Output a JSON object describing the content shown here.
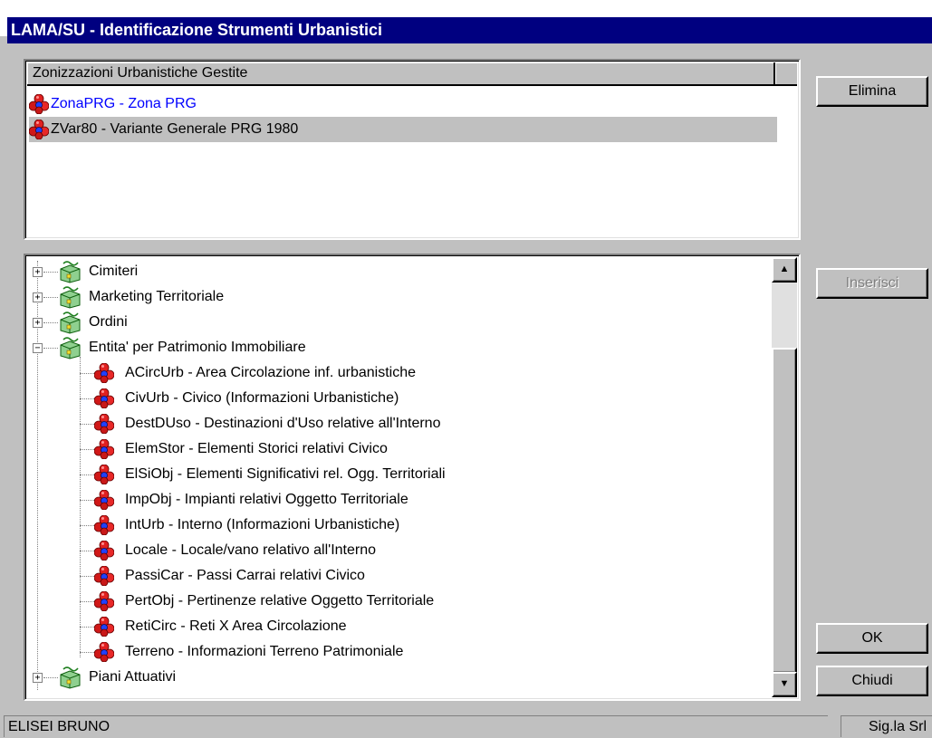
{
  "window": {
    "title": "LAMA/SU - Identificazione Strumenti Urbanistici"
  },
  "managed_list": {
    "header": "Zonizzazioni Urbanistiche Gestite",
    "items": [
      {
        "label": "ZonaPRG - Zona PRG",
        "icon": "entity-cluster-icon"
      },
      {
        "label": "ZVar80 - Variante Generale PRG 1980",
        "icon": "entity-cluster-icon"
      }
    ]
  },
  "tree": {
    "groups": [
      {
        "label": "Cimiteri",
        "expanded": false,
        "toggle": "+"
      },
      {
        "label": "Marketing Territoriale",
        "expanded": false,
        "toggle": "+"
      },
      {
        "label": "Ordini",
        "expanded": false,
        "toggle": "+"
      },
      {
        "label": "Entita' per Patrimonio Immobiliare",
        "expanded": true,
        "toggle": "−"
      },
      {
        "label": "Piani Attuativi",
        "expanded": false,
        "toggle": "+"
      }
    ],
    "children": [
      "ACircUrb - Area Circolazione inf. urbanistiche",
      "CivUrb - Civico (Informazioni Urbanistiche)",
      "DestDUso - Destinazioni d'Uso relative all'Interno",
      "ElemStor - Elementi Storici relativi Civico",
      "ElSiObj - Elementi Significativi rel. Ogg. Territoriali",
      "ImpObj - Impianti relativi Oggetto Territoriale",
      "IntUrb - Interno (Informazioni Urbanistiche)",
      "Locale - Locale/vano relativo all'Interno",
      "PassiCar - Passi Carrai relativi Civico",
      "PertObj - Pertinenze relative Oggetto Territoriale",
      "RetiCirc - Reti X Area Circolazione",
      "Terreno - Informazioni Terreno Patrimoniale"
    ]
  },
  "buttons": {
    "elimina": "Elimina",
    "inserisci": "Inserisci",
    "ok": "OK",
    "chiudi": "Chiudi"
  },
  "status": {
    "user": "ELISEI BRUNO",
    "company": "Sig.la Srl"
  },
  "colors": {
    "title_bar": "#000080",
    "link_text": "#0000ff",
    "window_bg": "#c0c0c0"
  }
}
